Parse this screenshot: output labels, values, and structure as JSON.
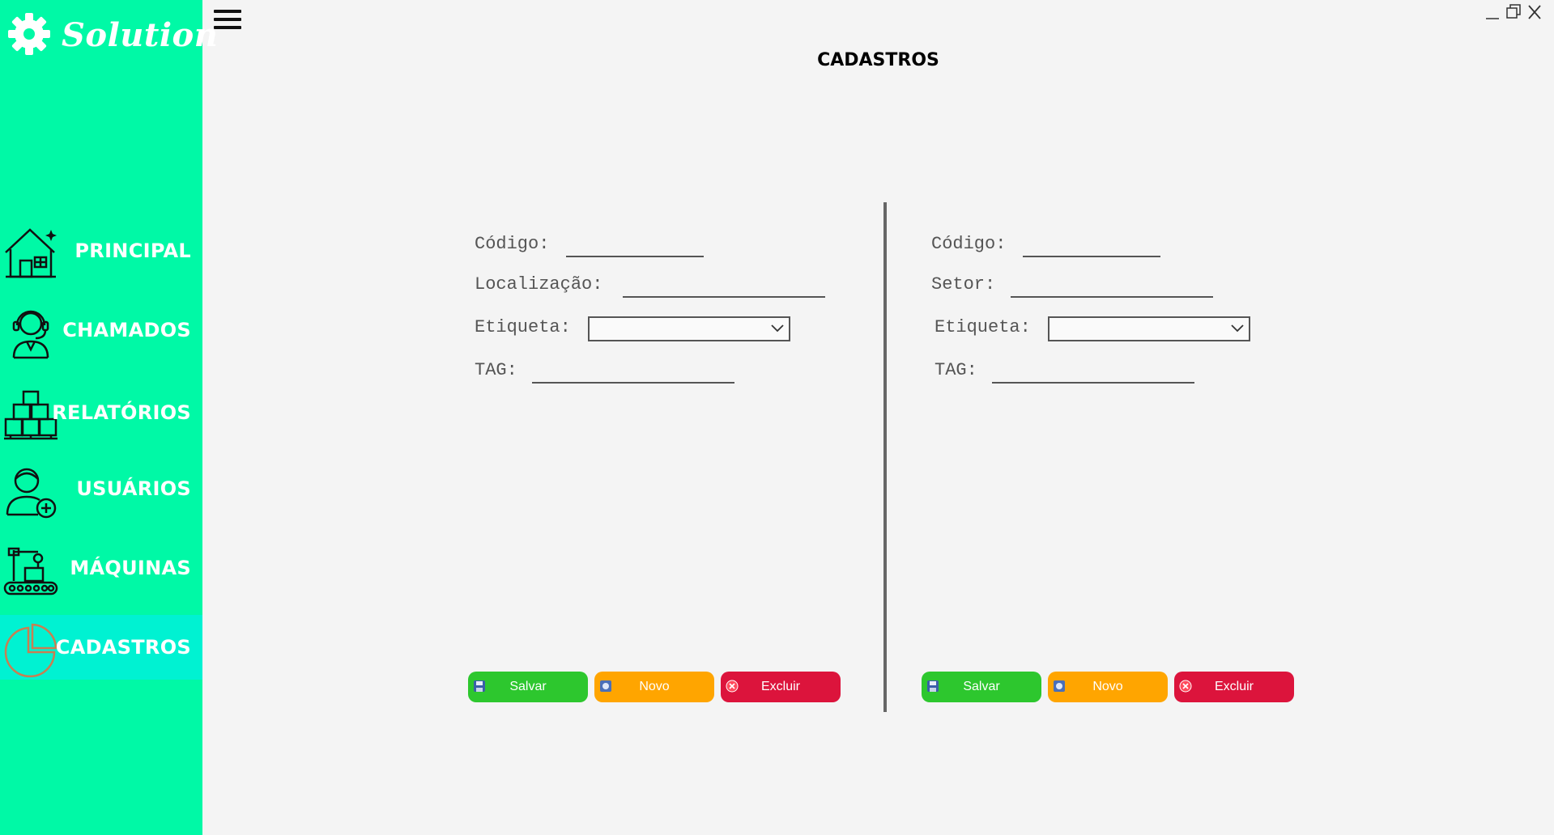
{
  "app": {
    "logo_text": "Solution"
  },
  "sidebar": {
    "items": [
      {
        "label": "PRINCIPAL",
        "icon": "house-icon"
      },
      {
        "label": "CHAMADOS",
        "icon": "support-agent-icon"
      },
      {
        "label": "RELATÓRIOS",
        "icon": "boxes-icon"
      },
      {
        "label": "USUÁRIOS",
        "icon": "add-user-icon"
      },
      {
        "label": "MÁQUINAS",
        "icon": "conveyor-robot-icon"
      },
      {
        "label": "CADASTROS",
        "icon": "pie-chart-icon",
        "active": true
      }
    ]
  },
  "header": {
    "title": "CADASTROS"
  },
  "left_form": {
    "codigo_label": "Código:",
    "localizacao_label": "Localização:",
    "etiqueta_label": "Etiqueta:",
    "tag_label": "TAG:"
  },
  "right_form": {
    "codigo_label": "Código:",
    "setor_label": "Setor:",
    "etiqueta_label": "Etiqueta:",
    "tag_label": "TAG:"
  },
  "buttons": {
    "save": "Salvar",
    "new": "Novo",
    "delete": "Excluir"
  },
  "colors": {
    "sidebar_bg": "#00f9a6",
    "active_item_bg": "#00f2d2",
    "save_button": "#2dc72e",
    "new_button": "#ffa500",
    "delete_button": "#dc143c"
  }
}
